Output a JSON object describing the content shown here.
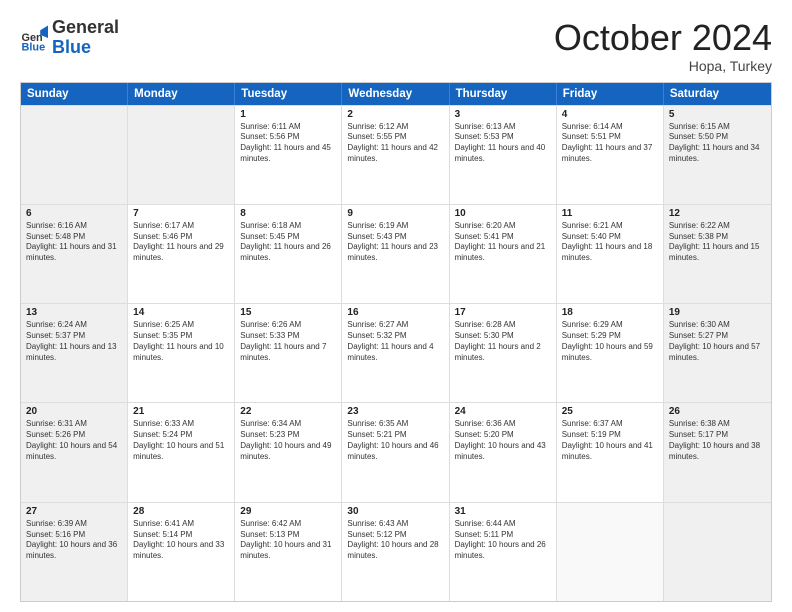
{
  "logo": {
    "general": "General",
    "blue": "Blue"
  },
  "header": {
    "month": "October 2024",
    "location": "Hopa, Turkey"
  },
  "weekdays": [
    "Sunday",
    "Monday",
    "Tuesday",
    "Wednesday",
    "Thursday",
    "Friday",
    "Saturday"
  ],
  "weeks": [
    [
      {
        "day": "",
        "info": "",
        "shaded": true
      },
      {
        "day": "",
        "info": "",
        "shaded": true
      },
      {
        "day": "1",
        "info": "Sunrise: 6:11 AM\nSunset: 5:56 PM\nDaylight: 11 hours and 45 minutes.",
        "shaded": false
      },
      {
        "day": "2",
        "info": "Sunrise: 6:12 AM\nSunset: 5:55 PM\nDaylight: 11 hours and 42 minutes.",
        "shaded": false
      },
      {
        "day": "3",
        "info": "Sunrise: 6:13 AM\nSunset: 5:53 PM\nDaylight: 11 hours and 40 minutes.",
        "shaded": false
      },
      {
        "day": "4",
        "info": "Sunrise: 6:14 AM\nSunset: 5:51 PM\nDaylight: 11 hours and 37 minutes.",
        "shaded": false
      },
      {
        "day": "5",
        "info": "Sunrise: 6:15 AM\nSunset: 5:50 PM\nDaylight: 11 hours and 34 minutes.",
        "shaded": true
      }
    ],
    [
      {
        "day": "6",
        "info": "Sunrise: 6:16 AM\nSunset: 5:48 PM\nDaylight: 11 hours and 31 minutes.",
        "shaded": true
      },
      {
        "day": "7",
        "info": "Sunrise: 6:17 AM\nSunset: 5:46 PM\nDaylight: 11 hours and 29 minutes.",
        "shaded": false
      },
      {
        "day": "8",
        "info": "Sunrise: 6:18 AM\nSunset: 5:45 PM\nDaylight: 11 hours and 26 minutes.",
        "shaded": false
      },
      {
        "day": "9",
        "info": "Sunrise: 6:19 AM\nSunset: 5:43 PM\nDaylight: 11 hours and 23 minutes.",
        "shaded": false
      },
      {
        "day": "10",
        "info": "Sunrise: 6:20 AM\nSunset: 5:41 PM\nDaylight: 11 hours and 21 minutes.",
        "shaded": false
      },
      {
        "day": "11",
        "info": "Sunrise: 6:21 AM\nSunset: 5:40 PM\nDaylight: 11 hours and 18 minutes.",
        "shaded": false
      },
      {
        "day": "12",
        "info": "Sunrise: 6:22 AM\nSunset: 5:38 PM\nDaylight: 11 hours and 15 minutes.",
        "shaded": true
      }
    ],
    [
      {
        "day": "13",
        "info": "Sunrise: 6:24 AM\nSunset: 5:37 PM\nDaylight: 11 hours and 13 minutes.",
        "shaded": true
      },
      {
        "day": "14",
        "info": "Sunrise: 6:25 AM\nSunset: 5:35 PM\nDaylight: 11 hours and 10 minutes.",
        "shaded": false
      },
      {
        "day": "15",
        "info": "Sunrise: 6:26 AM\nSunset: 5:33 PM\nDaylight: 11 hours and 7 minutes.",
        "shaded": false
      },
      {
        "day": "16",
        "info": "Sunrise: 6:27 AM\nSunset: 5:32 PM\nDaylight: 11 hours and 4 minutes.",
        "shaded": false
      },
      {
        "day": "17",
        "info": "Sunrise: 6:28 AM\nSunset: 5:30 PM\nDaylight: 11 hours and 2 minutes.",
        "shaded": false
      },
      {
        "day": "18",
        "info": "Sunrise: 6:29 AM\nSunset: 5:29 PM\nDaylight: 10 hours and 59 minutes.",
        "shaded": false
      },
      {
        "day": "19",
        "info": "Sunrise: 6:30 AM\nSunset: 5:27 PM\nDaylight: 10 hours and 57 minutes.",
        "shaded": true
      }
    ],
    [
      {
        "day": "20",
        "info": "Sunrise: 6:31 AM\nSunset: 5:26 PM\nDaylight: 10 hours and 54 minutes.",
        "shaded": true
      },
      {
        "day": "21",
        "info": "Sunrise: 6:33 AM\nSunset: 5:24 PM\nDaylight: 10 hours and 51 minutes.",
        "shaded": false
      },
      {
        "day": "22",
        "info": "Sunrise: 6:34 AM\nSunset: 5:23 PM\nDaylight: 10 hours and 49 minutes.",
        "shaded": false
      },
      {
        "day": "23",
        "info": "Sunrise: 6:35 AM\nSunset: 5:21 PM\nDaylight: 10 hours and 46 minutes.",
        "shaded": false
      },
      {
        "day": "24",
        "info": "Sunrise: 6:36 AM\nSunset: 5:20 PM\nDaylight: 10 hours and 43 minutes.",
        "shaded": false
      },
      {
        "day": "25",
        "info": "Sunrise: 6:37 AM\nSunset: 5:19 PM\nDaylight: 10 hours and 41 minutes.",
        "shaded": false
      },
      {
        "day": "26",
        "info": "Sunrise: 6:38 AM\nSunset: 5:17 PM\nDaylight: 10 hours and 38 minutes.",
        "shaded": true
      }
    ],
    [
      {
        "day": "27",
        "info": "Sunrise: 6:39 AM\nSunset: 5:16 PM\nDaylight: 10 hours and 36 minutes.",
        "shaded": true
      },
      {
        "day": "28",
        "info": "Sunrise: 6:41 AM\nSunset: 5:14 PM\nDaylight: 10 hours and 33 minutes.",
        "shaded": false
      },
      {
        "day": "29",
        "info": "Sunrise: 6:42 AM\nSunset: 5:13 PM\nDaylight: 10 hours and 31 minutes.",
        "shaded": false
      },
      {
        "day": "30",
        "info": "Sunrise: 6:43 AM\nSunset: 5:12 PM\nDaylight: 10 hours and 28 minutes.",
        "shaded": false
      },
      {
        "day": "31",
        "info": "Sunrise: 6:44 AM\nSunset: 5:11 PM\nDaylight: 10 hours and 26 minutes.",
        "shaded": false
      },
      {
        "day": "",
        "info": "",
        "shaded": false
      },
      {
        "day": "",
        "info": "",
        "shaded": true
      }
    ]
  ]
}
